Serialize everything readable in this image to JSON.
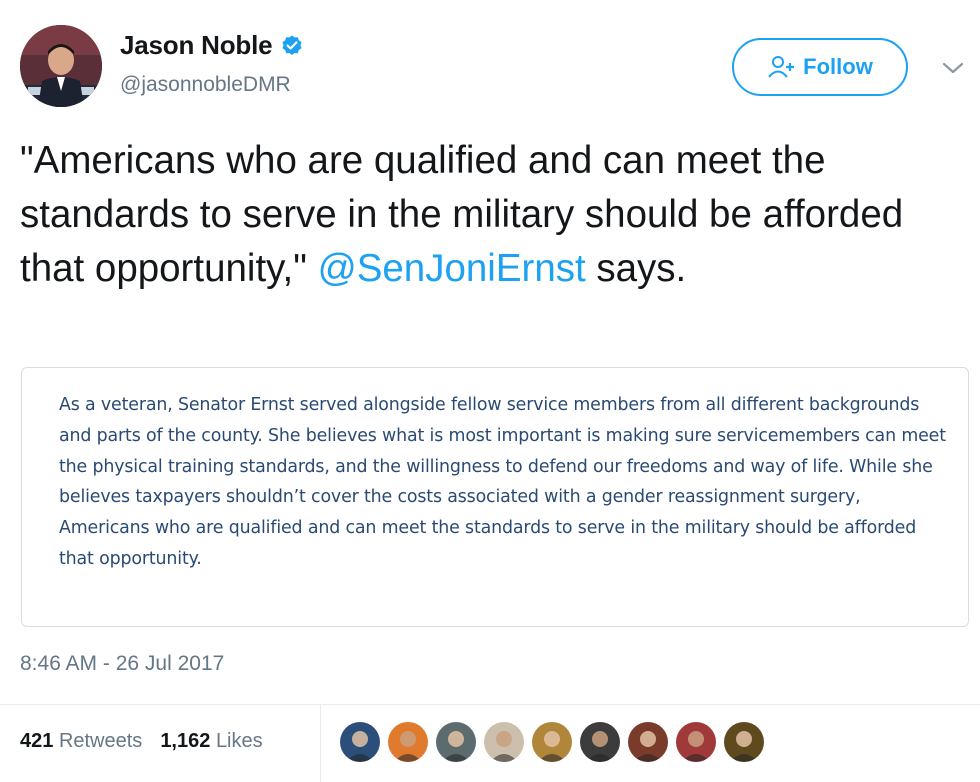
{
  "author": {
    "display_name": "Jason Noble",
    "handle": "@jasonnobleDMR",
    "verified_icon": "verified-badge-icon"
  },
  "follow_button": {
    "label": "Follow",
    "icon": "add-person-icon"
  },
  "menu_icon": "chevron-down-icon",
  "tweet": {
    "text_before_mention": "\"Americans who are qualified and can meet the standards to serve in the military should be afforded that opportunity,\" ",
    "mention": "@SenJoniErnst",
    "text_after_mention": " says."
  },
  "quoted_image_text": "As a veteran, Senator Ernst served alongside fellow service members from all different backgrounds and parts of the county. She believes what is most important is making sure servicemembers can meet the physical training standards, and the willingness to defend our freedoms and way of life. While she believes taxpayers shouldn’t cover the costs associated with a gender reassignment surgery, Americans who are qualified and can meet the standards to serve in the military should be afforded that opportunity.",
  "timestamp": "8:46 AM - 26 Jul 2017",
  "stats": {
    "retweets_count": "421",
    "retweets_label": "Retweets",
    "likes_count": "1,162",
    "likes_label": "Likes"
  },
  "colors": {
    "accent": "#1da1f2",
    "text": "#14171a",
    "secondary_text": "#657786",
    "quote_text": "#2a4a73"
  },
  "liker_avatars": [
    {
      "color": "#2b4f7a"
    },
    {
      "color": "#e07a2e"
    },
    {
      "color": "#5b6b6e"
    },
    {
      "color": "#cdbfae"
    },
    {
      "color": "#b0863a"
    },
    {
      "color": "#3c3c3c"
    },
    {
      "color": "#7a3b2a"
    },
    {
      "color": "#a03a3a"
    },
    {
      "color": "#5e4a1e"
    }
  ]
}
